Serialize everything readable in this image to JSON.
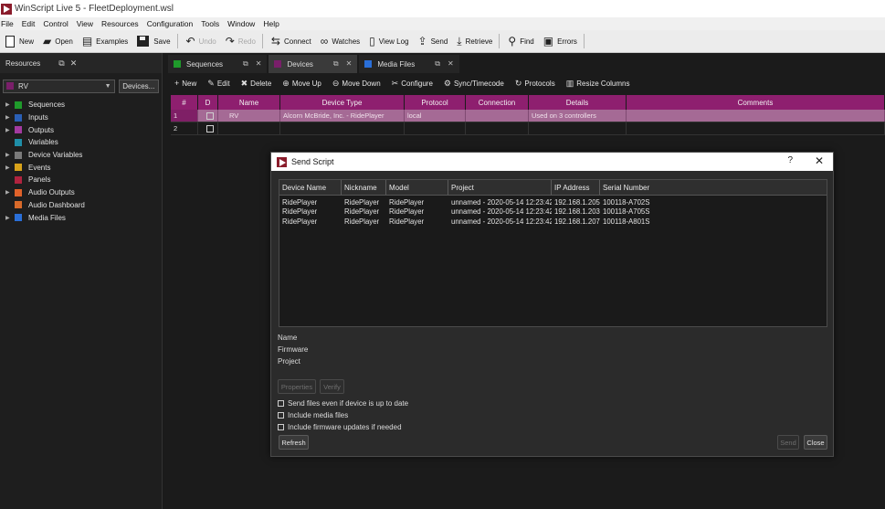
{
  "window": {
    "title": "WinScript Live 5 - FleetDeployment.wsl"
  },
  "menu": [
    "File",
    "Edit",
    "Control",
    "View",
    "Resources",
    "Configuration",
    "Tools",
    "Window",
    "Help"
  ],
  "toolbar": {
    "new": "New",
    "open": "Open",
    "examples": "Examples",
    "save": "Save",
    "undo": "Undo",
    "redo": "Redo",
    "connect": "Connect",
    "watches": "Watches",
    "view_log": "View Log",
    "send": "Send",
    "retrieve": "Retrieve",
    "find": "Find",
    "errors": "Errors"
  },
  "resources": {
    "title": "Resources",
    "selected": "RV",
    "devices_button": "Devices...",
    "tree": [
      {
        "label": "Sequences",
        "color": "#1f9a2b",
        "expandable": true
      },
      {
        "label": "Inputs",
        "color": "#2a5fb5",
        "expandable": true
      },
      {
        "label": "Outputs",
        "color": "#a33aa0",
        "expandable": true
      },
      {
        "label": "Variables",
        "color": "#1f8ea8",
        "expandable": false
      },
      {
        "label": "Device Variables",
        "color": "#7a7a7a",
        "expandable": true
      },
      {
        "label": "Events",
        "color": "#d8a21a",
        "expandable": true
      },
      {
        "label": "Panels",
        "color": "#b0233f",
        "expandable": false
      },
      {
        "label": "Audio Outputs",
        "color": "#e0622a",
        "expandable": true
      },
      {
        "label": "Audio Dashboard",
        "color": "#d86a2a",
        "expandable": false
      },
      {
        "label": "Media Files",
        "color": "#2a6fd8",
        "expandable": true
      }
    ]
  },
  "tabs": [
    {
      "label": "Sequences",
      "color": "#1f9a2b",
      "active": false
    },
    {
      "label": "Devices",
      "color": "#7a1f6a",
      "active": true
    },
    {
      "label": "Media Files",
      "color": "#2a6fd8",
      "active": false
    }
  ],
  "devices_toolbar": {
    "new": "New",
    "edit": "Edit",
    "delete": "Delete",
    "move_up": "Move Up",
    "move_down": "Move Down",
    "configure": "Configure",
    "sync": "Sync/Timecode",
    "protocols": "Protocols",
    "resize": "Resize Columns"
  },
  "devices_grid": {
    "columns": [
      "#",
      "D",
      "Name",
      "Device Type",
      "Protocol",
      "Connection",
      "Details",
      "Comments"
    ],
    "rows": [
      {
        "num": "1",
        "name": "RV",
        "device_type": "Alcorn McBride, Inc. - RidePlayer",
        "protocol": "local",
        "connection": "",
        "details": "Used on 3 controllers",
        "comments": ""
      },
      {
        "num": "2",
        "name": "",
        "device_type": "",
        "protocol": "",
        "connection": "",
        "details": "",
        "comments": ""
      }
    ]
  },
  "dialog": {
    "title": "Send Script",
    "help": "?",
    "close_x": "✕",
    "columns": [
      "Device Name",
      "Nickname",
      "Model",
      "Project",
      "IP Address",
      "Serial Number"
    ],
    "rows": [
      {
        "device_name": "RidePlayer",
        "nickname": "RidePlayer",
        "model": "RidePlayer",
        "project": "unnamed - 2020-05-14 12:23:42",
        "ip": "192.168.1.205",
        "serial": "100118-A702S"
      },
      {
        "device_name": "RidePlayer",
        "nickname": "RidePlayer",
        "model": "RidePlayer",
        "project": "unnamed - 2020-05-14 12:23:42",
        "ip": "192.168.1.203",
        "serial": "100118-A705S"
      },
      {
        "device_name": "RidePlayer",
        "nickname": "RidePlayer",
        "model": "RidePlayer",
        "project": "unnamed - 2020-05-14 12:23:42",
        "ip": "192.168.1.207",
        "serial": "100118-A801S"
      }
    ],
    "info": {
      "name": "Name",
      "firmware": "Firmware",
      "project": "Project"
    },
    "properties": "Properties",
    "verify": "Verify",
    "options": [
      "Send files even if device is up to date",
      "Include media files",
      "Include firmware updates if needed"
    ],
    "refresh": "Refresh",
    "send": "Send",
    "close": "Close"
  }
}
